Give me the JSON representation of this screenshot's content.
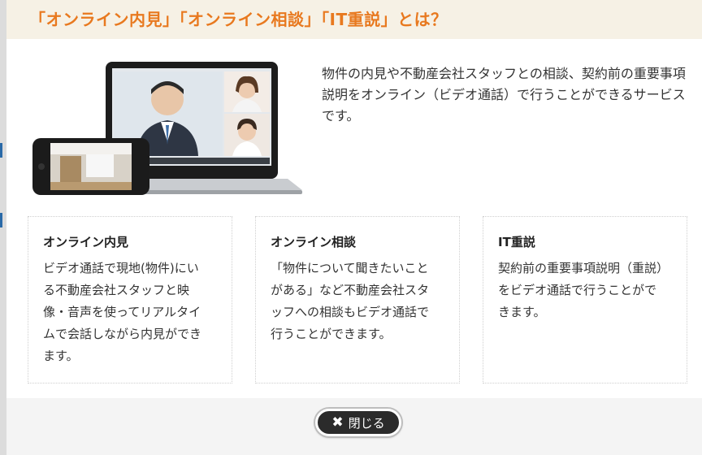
{
  "modal": {
    "title": "「オンライン内見」「オンライン相談」「IT重説」とは？",
    "intro": "物件の内見や不動産会社スタッフとの相談、契約前の重要事項説明をオンライン（ビデオ通話）で行うことができるサービスです。"
  },
  "cards": [
    {
      "title": "オンライン内見",
      "body": "ビデオ通話で現地(物件)にいる不動産会社スタッフと映像・音声を使ってリアルタイムで会話しながら内見ができます。"
    },
    {
      "title": "オンライン相談",
      "body": "「物件について聞きたいことがある」など不動産会社スタッフへの相談もビデオ通話で行うことができます。"
    },
    {
      "title": "IT重説",
      "body": "契約前の重要事項説明（重説）をビデオ通話で行うことができます。"
    }
  ],
  "footer": {
    "close_label": "閉じる"
  },
  "colors": {
    "accent": "#e8791f",
    "header_bg": "#f6f1e5",
    "button_bg": "#2b2b2b"
  }
}
